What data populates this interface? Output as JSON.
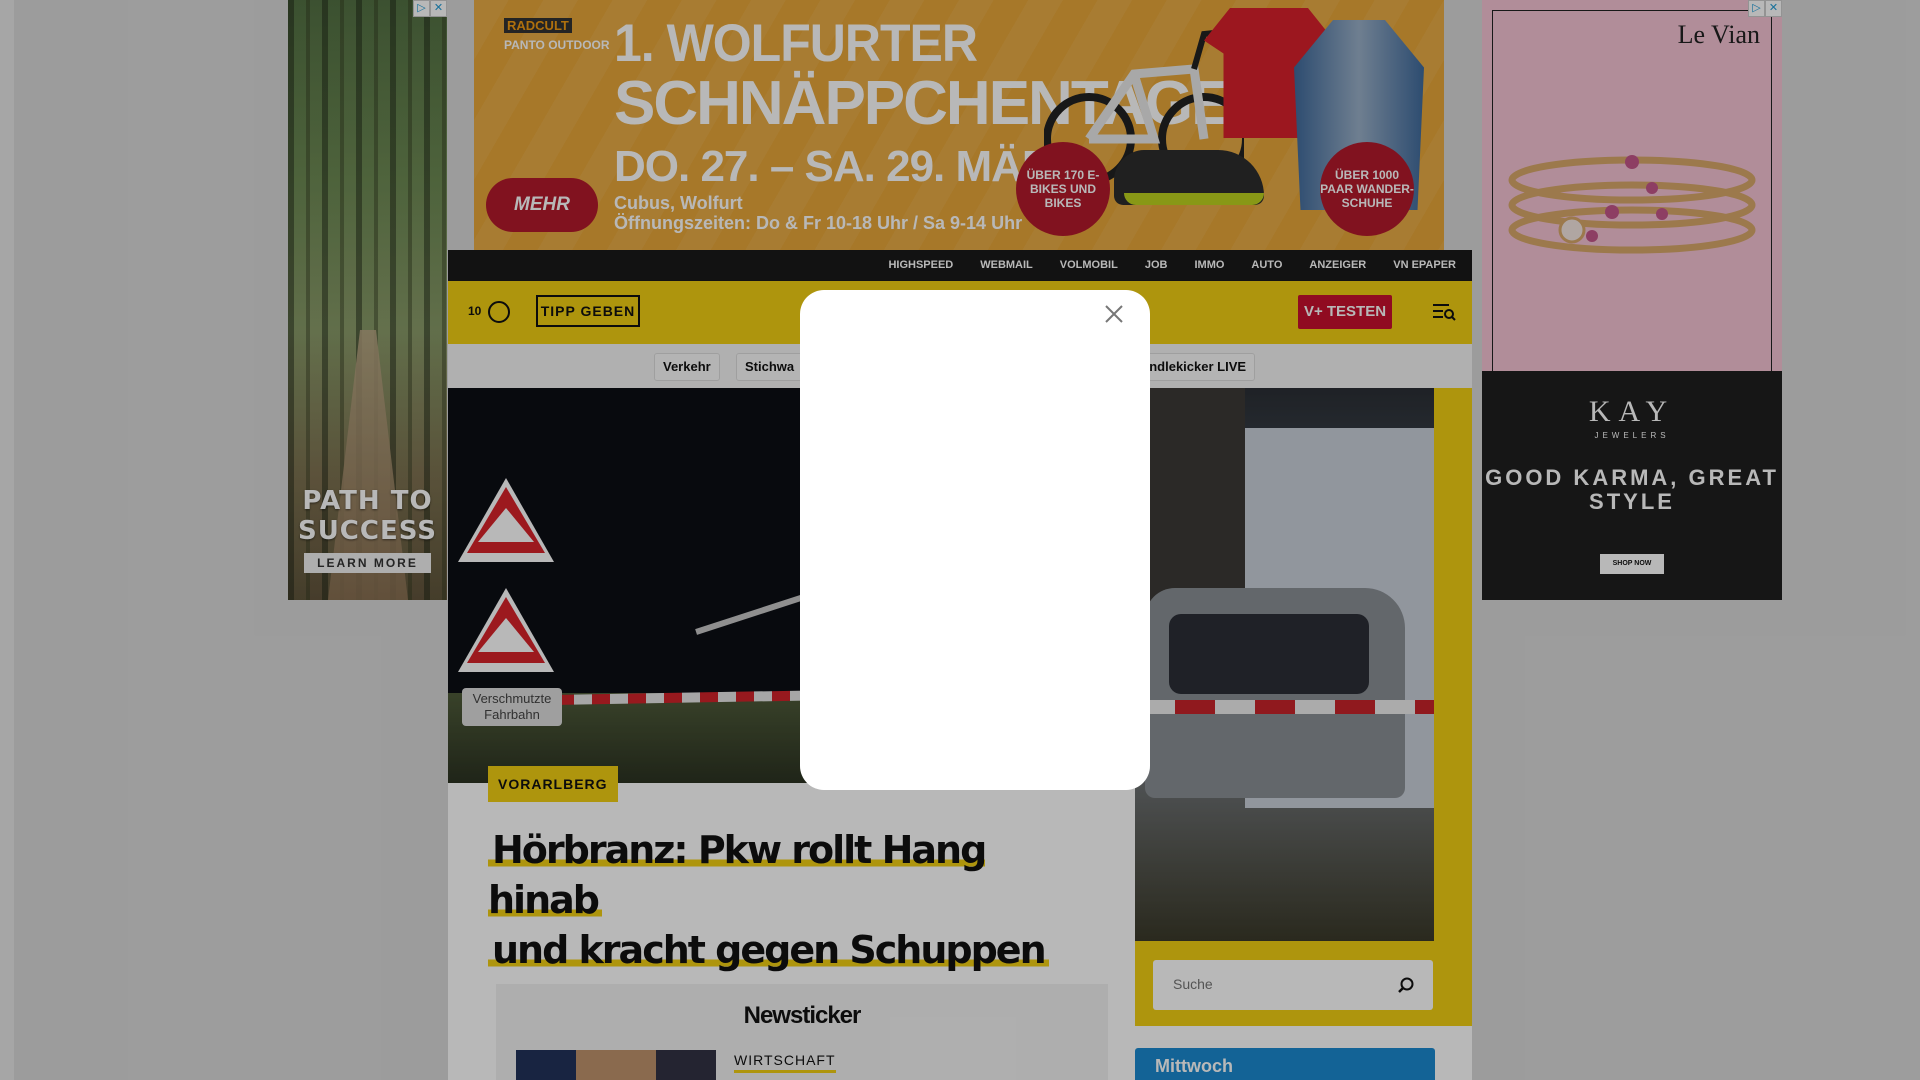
{
  "ads": {
    "left": {
      "headline": "PATH TO SUCCESS",
      "cta": "LEARN MORE"
    },
    "top": {
      "logo1": "RADCULT",
      "logo2": "PANTO OUTDOOR",
      "line1": "1. WOLFURTER",
      "line2": "SCHNÄPPCHENTAGE",
      "line3": "DO. 27. – SA. 29. MÄRZ",
      "location": "Cubus, Wolfurt",
      "hours": "Öffnungszeiten: Do & Fr 10-18 Uhr / Sa 9-14 Uhr",
      "more": "MEHR INFOS",
      "badge1": "ÜBER 170 E-BIKES UND BIKES",
      "badge2": "ÜBER 1000 PAAR WANDER-SCHUHE"
    },
    "right": {
      "brand": "Le Vian",
      "kay": "KAY",
      "jewelers": "JEWELERS",
      "slogan": "GOOD KARMA, GREAT STYLE",
      "shop": "SHOP NOW"
    }
  },
  "topnav": [
    "HIGHSPEED",
    "WEBMAIL",
    "VOLMOBIL",
    "JOB",
    "IMMO",
    "AUTO",
    "ANZEIGER",
    "VN EPAPER"
  ],
  "header": {
    "count": "10",
    "tipp": "TIPP GEBEN",
    "vplus": "V+ TESTEN"
  },
  "subnav": {
    "chip1": "Verkehr",
    "chip2": "Stichwa",
    "chip3": "ändlekicker LIVE"
  },
  "article": {
    "kicker": "VORARLBERG",
    "headline_line1": "Hörbranz: Pkw rollt Hang hinab",
    "headline_line2": "und kracht gegen Schuppen",
    "sign_text": "Verschmutzte Fahrbahn"
  },
  "newsticker": {
    "title": "Newsticker",
    "category": "WIRTSCHAFT"
  },
  "search": {
    "placeholder": "Suche"
  },
  "weather": {
    "day": "Mittwoch"
  }
}
